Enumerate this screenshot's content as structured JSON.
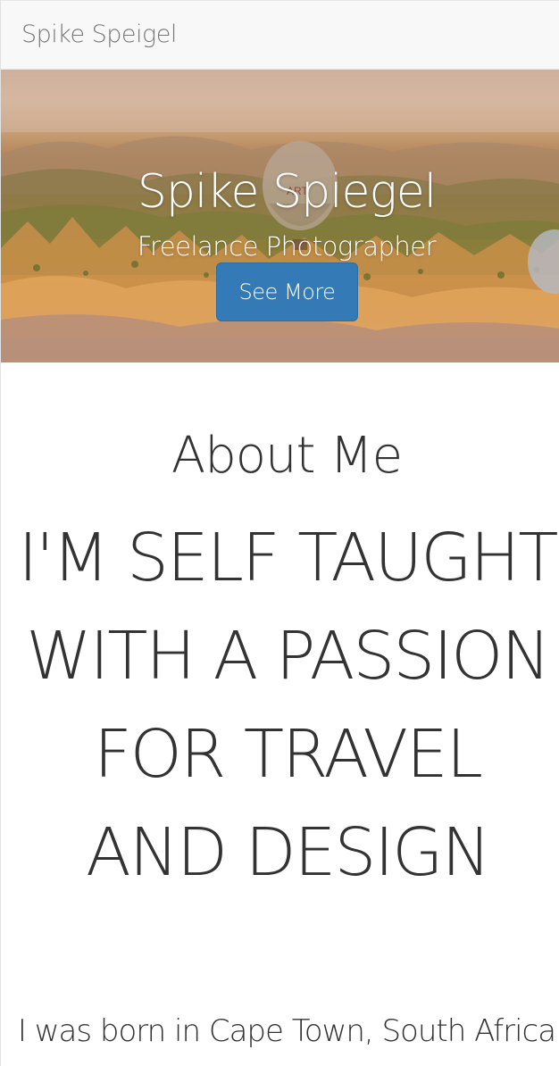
{
  "navbar": {
    "brand": "Spike Speigel"
  },
  "hero": {
    "title": "Spike Spiegel",
    "subtitle": "Freelance Photographer",
    "button_label": "See More"
  },
  "about": {
    "heading": "About Me",
    "tagline": "I'M SELF TAUGHT WITH A PASSION FOR TRAVEL AND DESIGN",
    "body": "I was born in Cape Town, South Africa"
  },
  "colors": {
    "navbar_bg": "#f8f8f8",
    "brand_text": "#777777",
    "primary_button": "#337ab7",
    "body_text": "#333333"
  }
}
